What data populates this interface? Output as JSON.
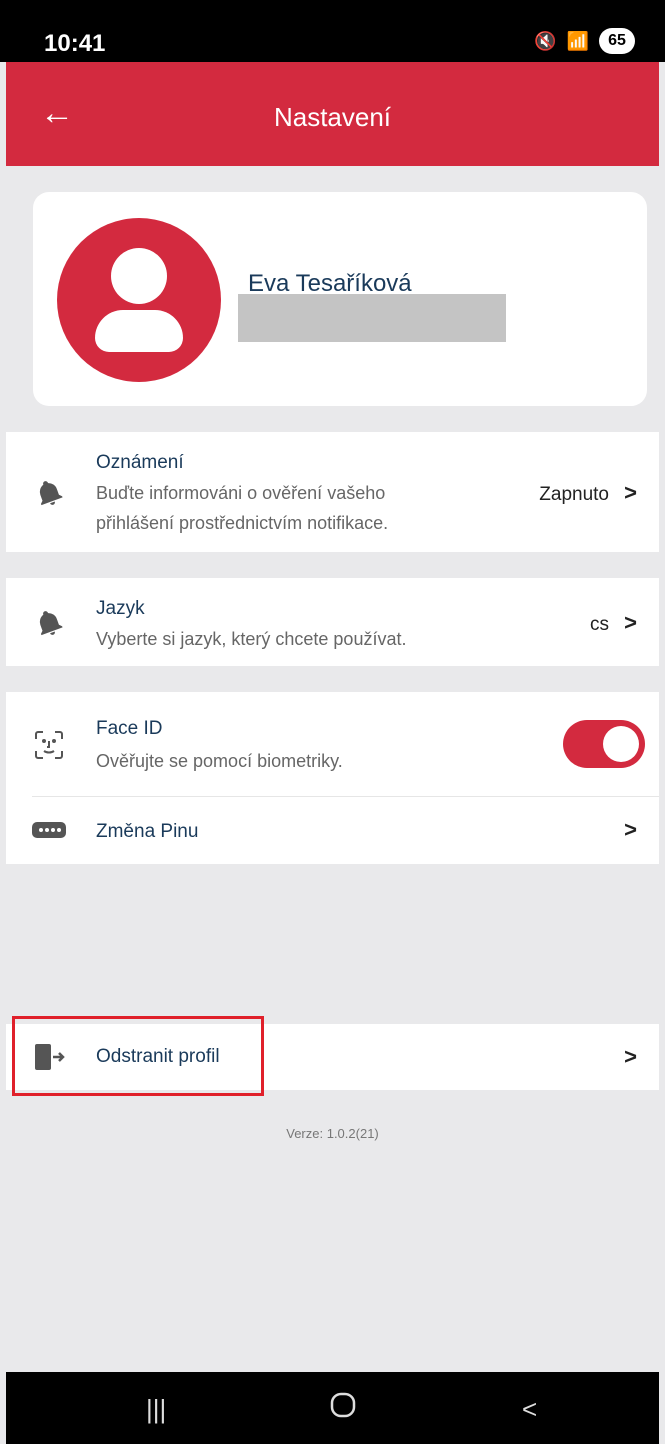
{
  "status": {
    "time": "10:41",
    "battery": "65"
  },
  "header": {
    "title": "Nastavení"
  },
  "profile": {
    "name": "Eva Tesaříková"
  },
  "settings": {
    "notifications": {
      "title": "Oznámení",
      "desc_line1": "Buďte informováni o ověření vašeho",
      "desc_line2": "přihlášení prostřednictvím notifikace.",
      "value": "Zapnuto"
    },
    "language": {
      "title": "Jazyk",
      "desc": "Vyberte si jazyk, který chcete používat.",
      "value": "cs"
    },
    "faceid": {
      "title": "Face ID",
      "desc": "Ověřujte se pomocí biometriky.",
      "enabled": true
    },
    "pin": {
      "title": "Změna Pinu"
    },
    "remove": {
      "title": "Odstranit profil"
    }
  },
  "version": "Verze: 1.0.2(21)",
  "colors": {
    "accent": "#d32a3f",
    "highlight": "#e0202a"
  }
}
